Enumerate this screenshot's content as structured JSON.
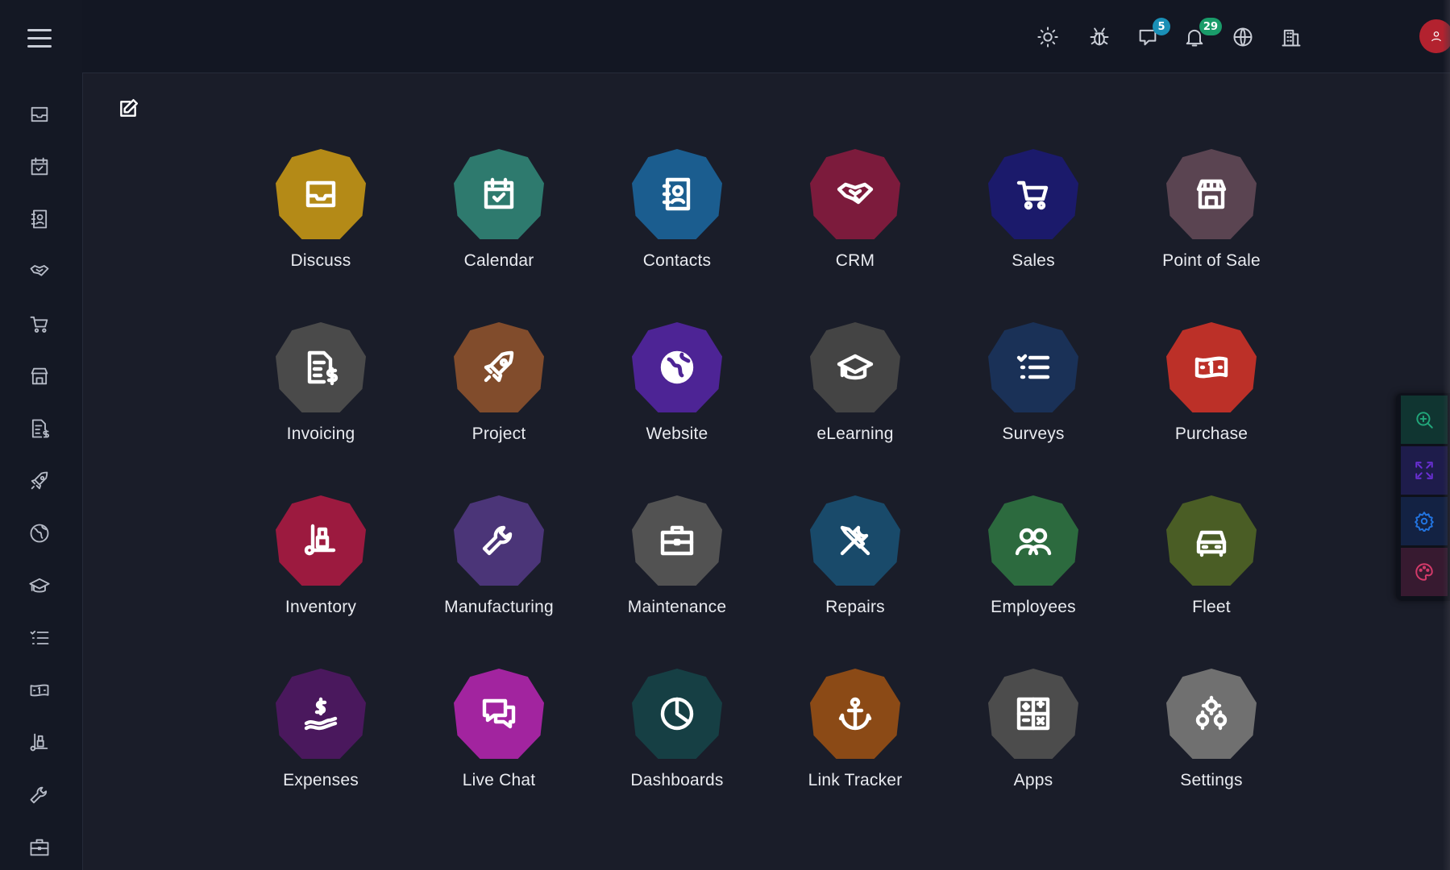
{
  "topbar": {
    "icons": [
      "sun-icon",
      "bug-icon",
      "chat-icon",
      "bell-icon",
      "globe-icon",
      "building-icon"
    ],
    "chat_badge": "5",
    "notifications_badge": "29",
    "avatar_icon": "user-icon",
    "more_icon": "kebab-icon"
  },
  "sidebar": {
    "toggle_icon": "hamburger-icon",
    "items": [
      "inbox-icon",
      "calendar-icon",
      "contacts-icon",
      "handshake-icon",
      "cart-icon",
      "store-icon",
      "invoice-icon",
      "rocket-icon",
      "globe-icon",
      "graduation-cap-icon",
      "list-check-icon",
      "money-icon",
      "hand-truck-icon",
      "wrench-icon",
      "briefcase-icon"
    ]
  },
  "edit_icon": "edit-icon",
  "apps": [
    {
      "label": "Discuss",
      "color": "#b48a17",
      "icon": "inbox-icon"
    },
    {
      "label": "Calendar",
      "color": "#2e7a6e",
      "icon": "calendar-icon"
    },
    {
      "label": "Contacts",
      "color": "#1b5d8f",
      "icon": "contacts-icon"
    },
    {
      "label": "CRM",
      "color": "#7c1b3c",
      "icon": "handshake-icon"
    },
    {
      "label": "Sales",
      "color": "#1b1a6b",
      "icon": "cart-icon"
    },
    {
      "label": "Point of Sale",
      "color": "#5a4451",
      "icon": "store-icon"
    },
    {
      "label": "Invoicing",
      "color": "#4a4a4a",
      "icon": "invoice-icon"
    },
    {
      "label": "Project",
      "color": "#814c2c",
      "icon": "rocket-icon"
    },
    {
      "label": "Website",
      "color": "#4d2495",
      "icon": "globe-icon"
    },
    {
      "label": "eLearning",
      "color": "#444444",
      "icon": "graduation-cap-icon"
    },
    {
      "label": "Surveys",
      "color": "#1a3157",
      "icon": "list-check-icon"
    },
    {
      "label": "Purchase",
      "color": "#bc3028",
      "icon": "money-icon"
    },
    {
      "label": "Inventory",
      "color": "#9c1a3f",
      "icon": "hand-truck-icon"
    },
    {
      "label": "Manufacturing",
      "color": "#4b3578",
      "icon": "wrench-icon"
    },
    {
      "label": "Maintenance",
      "color": "#525252",
      "icon": "briefcase-icon"
    },
    {
      "label": "Repairs",
      "color": "#194a6a",
      "icon": "tools-icon"
    },
    {
      "label": "Employees",
      "color": "#2c6a3e",
      "icon": "users-icon"
    },
    {
      "label": "Fleet",
      "color": "#4a5d25",
      "icon": "car-icon"
    },
    {
      "label": "Expenses",
      "color": "#4a185d",
      "icon": "hand-dollar-icon"
    },
    {
      "label": "Live Chat",
      "color": "#a2249f",
      "icon": "chat-bubbles-icon"
    },
    {
      "label": "Dashboards",
      "color": "#163f44",
      "icon": "pie-chart-icon"
    },
    {
      "label": "Link Tracker",
      "color": "#8b4a16",
      "icon": "anchor-icon"
    },
    {
      "label": "Apps",
      "color": "#4c4c4c",
      "icon": "apps-grid-icon"
    },
    {
      "label": "Settings",
      "color": "#707070",
      "icon": "gears-icon"
    }
  ],
  "right_rail": {
    "buttons": [
      {
        "icon": "zoom-in-icon",
        "color": "#21a67a",
        "bg": "#103531"
      },
      {
        "icon": "fullscreen-icon",
        "color": "#6a2fd4",
        "bg": "#1e1c4b"
      },
      {
        "icon": "settings-icon",
        "color": "#2274e0",
        "bg": "#132243"
      },
      {
        "icon": "palette-icon",
        "color": "#d43a6a",
        "bg": "#371a30"
      }
    ]
  }
}
